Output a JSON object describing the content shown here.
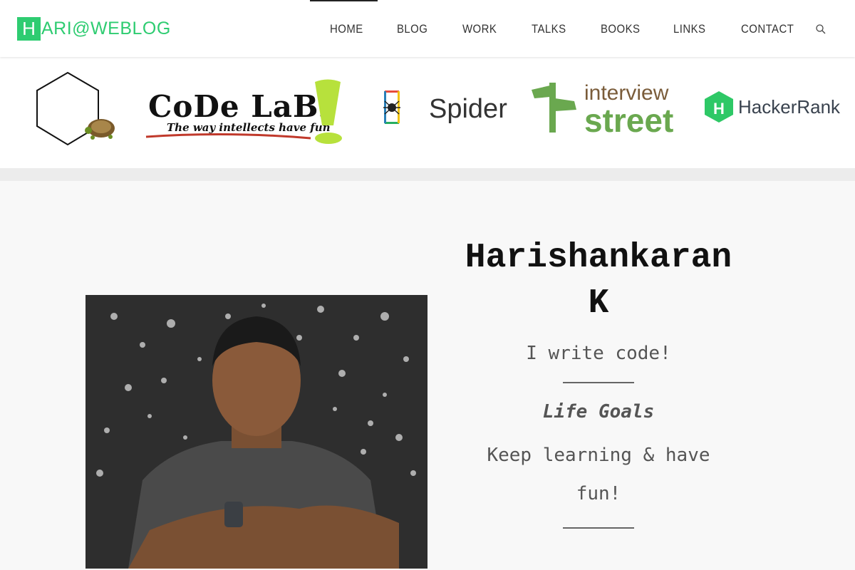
{
  "header": {
    "logo_letter": "H",
    "logo_text": "ARI@WEBLOG",
    "nav": [
      {
        "label": "HOME",
        "active": true
      },
      {
        "label": "BLOG"
      },
      {
        "label": "WORK"
      },
      {
        "label": "TALKS"
      },
      {
        "label": "BOOKS"
      },
      {
        "label": "LINKS"
      },
      {
        "label": "CONTACT"
      }
    ],
    "search_icon": "search-icon"
  },
  "logos": {
    "codelabs_title": "CoDe LaBs",
    "codelabs_tagline": "The way intellects have fun",
    "spider": "Spider",
    "interviewstreet_1": "interview",
    "interviewstreet_2": "street",
    "hackerrank_letter": "H",
    "hackerrank": "HackerRank"
  },
  "profile": {
    "name_line1": "Harishankaran",
    "name_line2": "K",
    "tagline": "I write code!",
    "goals_heading": "Life Goals",
    "goals_line1": "Keep learning & have",
    "goals_line2": "fun!"
  },
  "colors": {
    "brand_green": "#2ecc71",
    "text_dark": "#111111",
    "text_muted": "#555555"
  }
}
